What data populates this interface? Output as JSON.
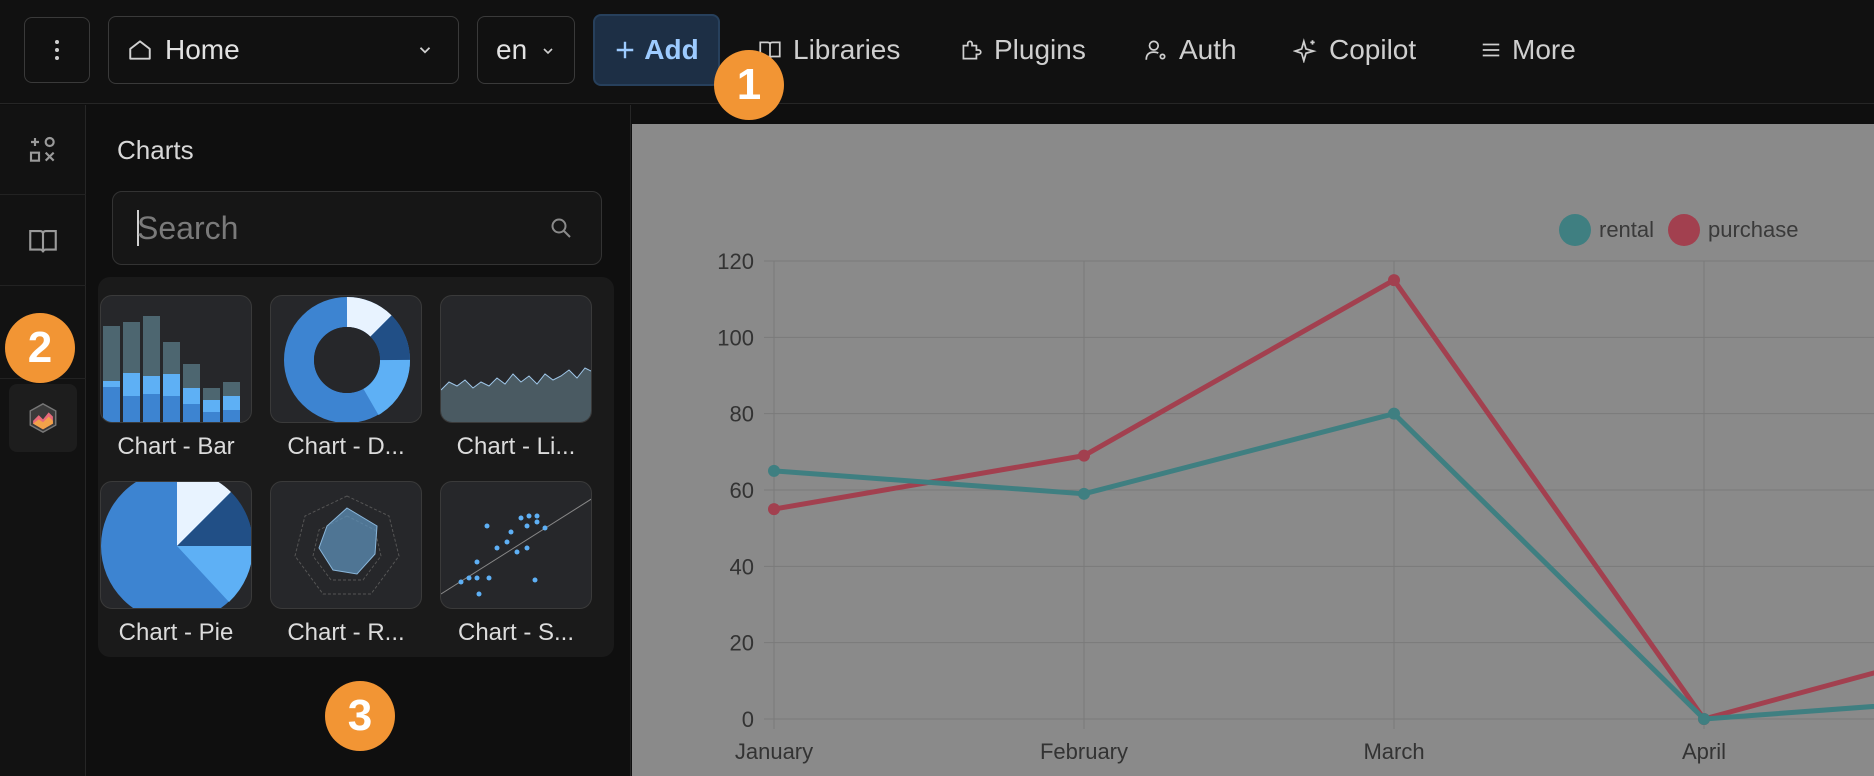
{
  "header": {
    "menu_icon": "vertical-dots-icon",
    "home_label": "Home",
    "language_value": "en",
    "add_label": "Add",
    "nav": [
      {
        "label": "Libraries",
        "icon": "book-icon"
      },
      {
        "label": "Plugins",
        "icon": "puzzle-icon"
      },
      {
        "label": "Auth",
        "icon": "user-key-icon"
      },
      {
        "label": "Copilot",
        "icon": "sparkle-icon"
      },
      {
        "label": "More",
        "icon": "hamburger-icon"
      }
    ]
  },
  "badges": [
    "1",
    "2",
    "3"
  ],
  "sidebar": {
    "items": [
      {
        "icon": "blocks-icon"
      },
      {
        "icon": "book-icon"
      },
      {
        "icon": "chart-plugin-icon"
      }
    ]
  },
  "panel": {
    "title": "Charts",
    "search_placeholder": "Search",
    "cards": [
      {
        "label": "Chart - Bar"
      },
      {
        "label": "Chart - D..."
      },
      {
        "label": "Chart - Li..."
      },
      {
        "label": "Chart - Pie"
      },
      {
        "label": "Chart - R..."
      },
      {
        "label": "Chart - S..."
      }
    ]
  },
  "chart_data": {
    "type": "line",
    "categories": [
      "January",
      "February",
      "March",
      "April"
    ],
    "series": [
      {
        "name": "rental",
        "color": "#3f7f81",
        "values": [
          65,
          59,
          80,
          0
        ]
      },
      {
        "name": "purchase",
        "color": "#a2404f",
        "values": [
          55,
          69,
          115,
          0
        ]
      }
    ],
    "ylim": [
      0,
      120
    ],
    "yticks": [
      0,
      20,
      40,
      60,
      80,
      100,
      120
    ],
    "grid": true,
    "legend_position": "top-right"
  }
}
